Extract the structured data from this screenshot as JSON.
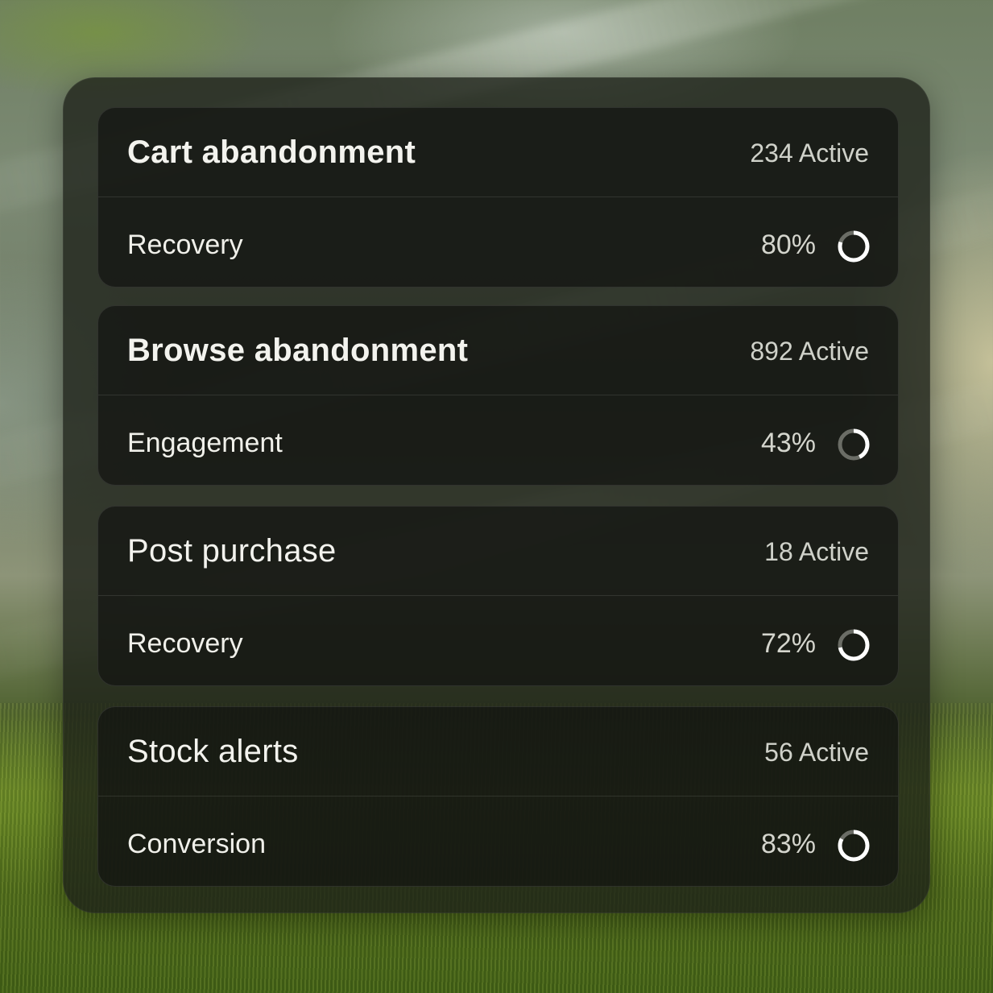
{
  "cards": [
    {
      "title": "Cart abandonment",
      "active": "234 Active",
      "metric_label": "Recovery",
      "metric_value": "80%",
      "progress": 0.8,
      "bold": true
    },
    {
      "title": "Browse abandonment",
      "active": "892 Active",
      "metric_label": "Engagement",
      "metric_value": "43%",
      "progress": 0.43,
      "bold": true
    },
    {
      "title": "Post purchase",
      "active": "18 Active",
      "metric_label": "Recovery",
      "metric_value": "72%",
      "progress": 0.72,
      "bold": false
    },
    {
      "title": "Stock alerts",
      "active": "56 Active",
      "metric_label": "Conversion",
      "metric_value": "83%",
      "progress": 0.83,
      "bold": false
    }
  ],
  "colors": {
    "ring_fill": "#ffffff",
    "ring_track": "#6b6d66"
  }
}
